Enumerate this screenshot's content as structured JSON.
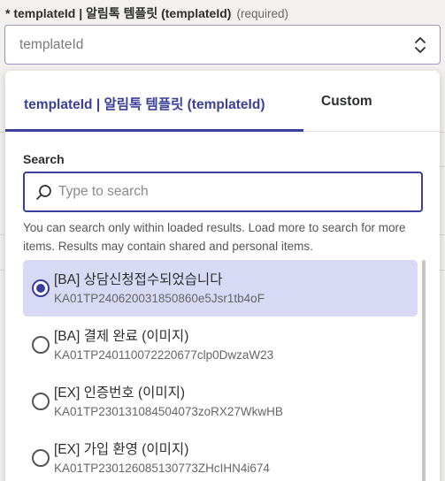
{
  "field": {
    "label": "* templateId | 알림톡 템플릿 (templateId)",
    "required_text": "(required)",
    "placeholder": "templateId"
  },
  "dropdown": {
    "tabs": [
      {
        "label": "templateId | 알림톡 템플릿 (templateId)",
        "active": true
      },
      {
        "label": "Custom",
        "active": false
      }
    ],
    "search": {
      "label": "Search",
      "placeholder": "Type to search",
      "hint": "You can search only within loaded results. Load more to search for more items. Results may contain shared and personal items."
    },
    "items": [
      {
        "title": "[BA] 상담신청접수되었습니다",
        "id": "KA01TP240620031850860e5Jsr1tb4oF",
        "selected": true
      },
      {
        "title": "[BA] 결제 완료 (이미지)",
        "id": "KA01TP240110072220677clp0DwzaW23",
        "selected": false
      },
      {
        "title": "[EX] 인증번호 (이미지)",
        "id": "KA01TP230131084504073zoRX27WkwHB",
        "selected": false
      },
      {
        "title": "[EX] 가입 환영 (이미지)",
        "id": "KA01TP230126085130773ZHcIHN4i674",
        "selected": false
      }
    ]
  },
  "colors": {
    "accent": "#3b3f9c",
    "selected_bg": "#d8d9f4"
  }
}
